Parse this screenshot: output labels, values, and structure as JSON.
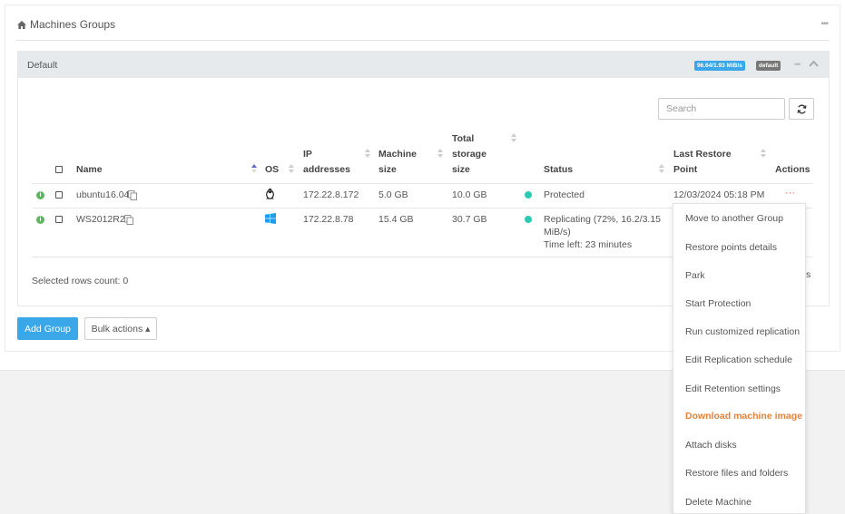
{
  "panel": {
    "title": "Machines Groups",
    "icon": "home-icon"
  },
  "group": {
    "name": "Default",
    "speed_badge": "96.64/1.93 MiB/s",
    "default_badge": "default"
  },
  "search": {
    "placeholder": "Search"
  },
  "table": {
    "headers": {
      "name": "Name",
      "os": "OS",
      "ip_line1": "IP",
      "ip_line2": "addresses",
      "size_line1": "Machine",
      "size_line2": "size",
      "total_line1": "Total",
      "total_line2": "storage",
      "total_line3": "size",
      "status": "Status",
      "restore_line1": "Last Restore",
      "restore_line2": "Point",
      "actions": "Actions"
    },
    "rows": [
      {
        "name": "ubuntu16.04",
        "os_icon": "linux-icon",
        "ip": "172.22.8.172",
        "size": "5.0 GB",
        "total": "10.0 GB",
        "status": "Protected",
        "last_restore": "12/03/2024 05:18 PM",
        "actions": "···"
      },
      {
        "name": "WS2012R2",
        "os_icon": "windows-icon",
        "ip": "172.22.8.78",
        "size": "15.4 GB",
        "total": "30.7 GB",
        "status_line1": "Replicating (72%, 16.2/3.15",
        "status_line2": "MiB/s)",
        "status_line3": "Time left: 23 minutes"
      }
    ],
    "selected_count": "Selected rows count: 0"
  },
  "buttons": {
    "add_group": "Add Group",
    "bulk_actions": "Bulk actions ▴"
  },
  "menu": {
    "items": [
      "Move to another Group",
      "Restore points details",
      "Park",
      "Start Protection",
      "Run customized replication",
      "Edit Replication schedule",
      "Edit Retention settings",
      "Download machine image",
      "Attach disks",
      "Restore files and folders",
      "Delete Machine"
    ],
    "highlighted_index": 7
  },
  "peek_text": "s",
  "colors": {
    "accent": "#3aa7e8",
    "status_green": "#2cc9b3",
    "highlight": "#e8813a",
    "info_green": "#5cb85c"
  }
}
